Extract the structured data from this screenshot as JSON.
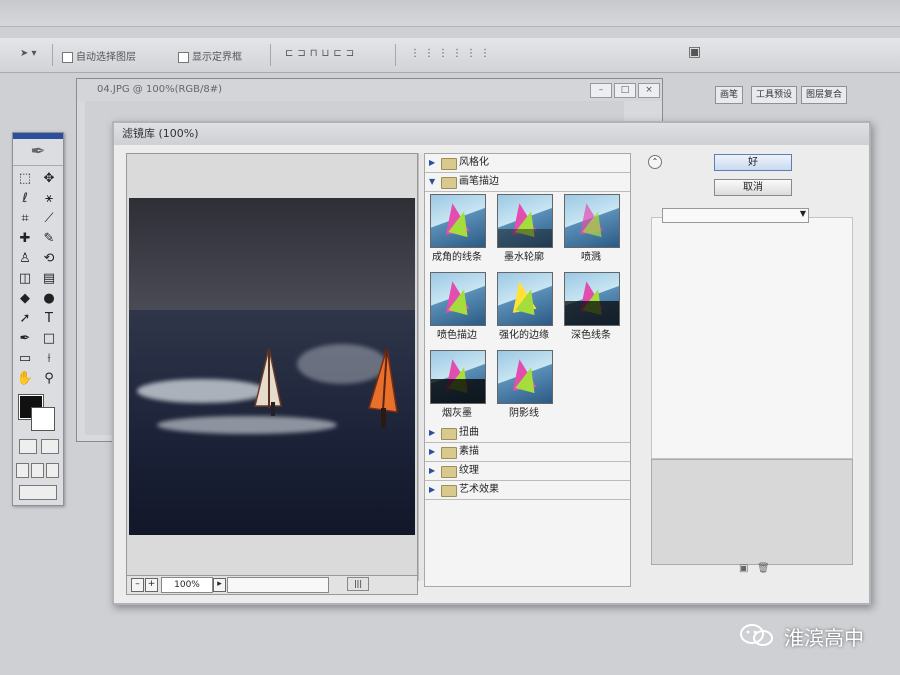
{
  "options_bar": {
    "auto_select": "自动选择图层",
    "show_bounds": "显示定界框"
  },
  "palette_tabs": [
    "画笔",
    "工具预设",
    "图层复合"
  ],
  "document": {
    "title": "04.JPG @ 100%(RGB/8#)"
  },
  "filter_gallery": {
    "title": "滤镜库 (100%)",
    "categories": [
      {
        "label": "风格化",
        "expanded": false
      },
      {
        "label": "画笔描边",
        "expanded": true
      },
      {
        "label": "扭曲",
        "expanded": false
      },
      {
        "label": "素描",
        "expanded": false
      },
      {
        "label": "纹理",
        "expanded": false
      },
      {
        "label": "艺术效果",
        "expanded": false
      }
    ],
    "brush_filters": [
      "成角的线条",
      "墨水轮廓",
      "喷溅",
      "喷色描边",
      "强化的边缘",
      "深色线条",
      "烟灰墨",
      "阴影线"
    ],
    "zoom": "100%",
    "ok_label": "好",
    "cancel_label": "取消"
  },
  "watermark": {
    "text": "淮滨高中"
  }
}
